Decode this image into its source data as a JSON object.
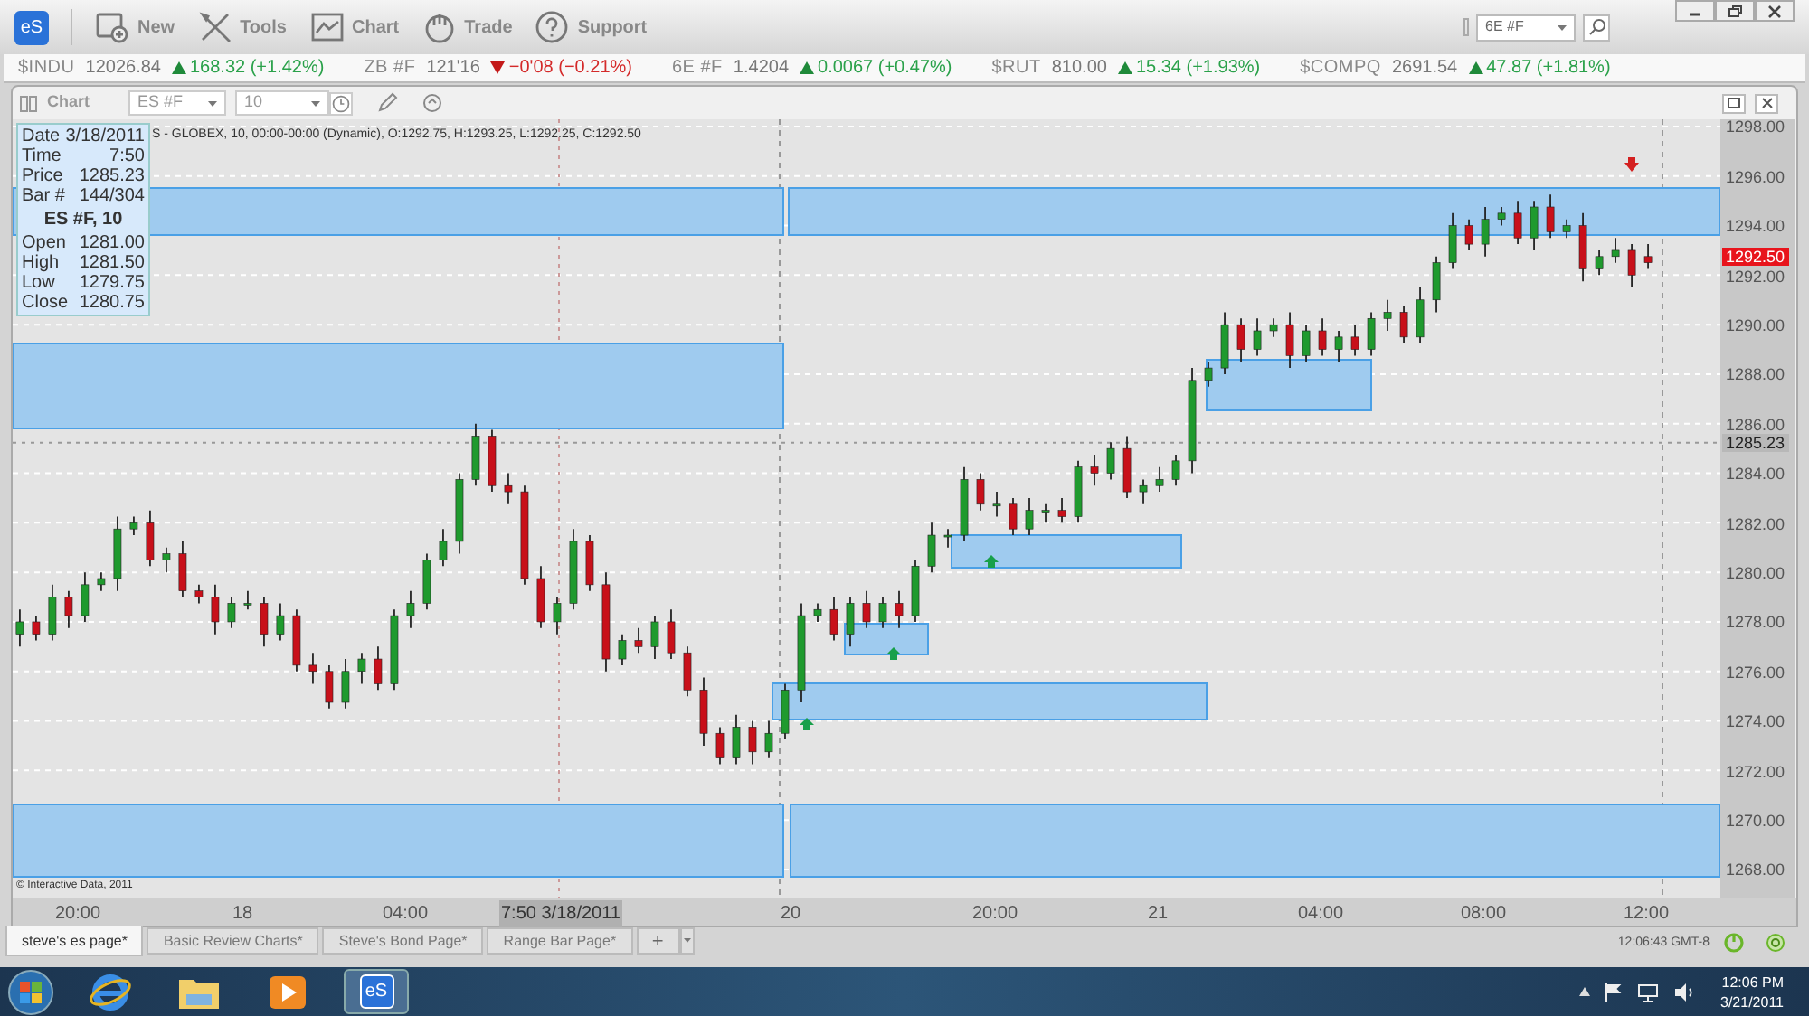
{
  "app": {
    "logo": "eS"
  },
  "toolbar": [
    {
      "kind": "new",
      "label": "New"
    },
    {
      "kind": "tools",
      "label": "Tools"
    },
    {
      "kind": "chart",
      "label": "Chart"
    },
    {
      "kind": "trade",
      "label": "Trade"
    },
    {
      "kind": "support",
      "label": "Support"
    }
  ],
  "symbol_search": {
    "value": "6E #F"
  },
  "ticker": [
    {
      "symbol": "$INDU",
      "last": "12026.84",
      "change": "168.32 (+1.42%)",
      "up": true
    },
    {
      "symbol": "ZB #F",
      "last": "121'16",
      "change": "−0'08 (−0.21%)",
      "up": false
    },
    {
      "symbol": "6E #F",
      "last": "1.4204",
      "change": "0.0067 (+0.47%)",
      "up": true
    },
    {
      "symbol": "$RUT",
      "last": "810.00",
      "change": "15.34 (+1.93%)",
      "up": true
    },
    {
      "symbol": "$COMPQ",
      "last": "2691.54",
      "change": "47.87 (+1.81%)",
      "up": true
    }
  ],
  "chart_window": {
    "title": "Chart",
    "symbol": "ES #F",
    "interval": "10",
    "info_line": "S - GLOBEX, 10, 00:00-00:00 (Dynamic), O:1292.75, H:1293.25, L:1292.25, C:1292.50",
    "data_box": {
      "rows_top": [
        {
          "label": "Date",
          "value": "3/18/2011"
        },
        {
          "label": "Time",
          "value": "7:50"
        },
        {
          "label": "Price",
          "value": "1285.23"
        },
        {
          "label": "Bar #",
          "value": "144/304"
        }
      ],
      "heading": "ES #F, 10",
      "rows_bottom": [
        {
          "label": "Open",
          "value": "1281.00"
        },
        {
          "label": "High",
          "value": "1281.50"
        },
        {
          "label": "Low",
          "value": "1279.75"
        },
        {
          "label": "Close",
          "value": "1280.75"
        }
      ]
    },
    "chart_data": {
      "type": "candlestick",
      "categories": [
        null,
        null,
        null,
        null,
        null,
        null,
        null,
        null,
        null,
        null,
        null,
        null,
        null,
        null,
        null,
        null,
        null,
        null,
        null,
        null,
        null,
        null,
        null,
        null,
        null,
        null,
        null,
        null,
        null,
        null,
        null,
        null,
        null,
        null,
        null,
        null,
        null,
        null,
        null,
        null,
        null,
        null,
        null,
        null,
        null,
        null,
        null,
        null,
        null,
        null,
        null,
        null,
        null,
        null,
        null,
        null,
        null,
        null,
        null,
        null,
        null,
        null,
        null,
        null,
        null,
        null,
        null,
        null,
        null,
        null,
        null,
        null,
        null,
        null,
        null,
        null,
        null,
        null,
        null,
        null,
        null,
        null,
        null,
        null,
        null,
        null,
        null,
        null,
        null,
        null,
        null,
        null,
        null,
        null,
        null,
        null,
        null,
        null,
        null,
        null,
        null
      ],
      "ohlc": [
        [
          1277.5,
          1278.5,
          1277,
          1278
        ],
        [
          1278,
          1278.25,
          1277.25,
          1277.5
        ],
        [
          1277.5,
          1279.5,
          1277.25,
          1279
        ],
        [
          1279,
          1279.25,
          1277.75,
          1278.25
        ],
        [
          1278.25,
          1280,
          1278,
          1279.5
        ],
        [
          1279.5,
          1280,
          1279.25,
          1279.75
        ],
        [
          1279.75,
          1282.25,
          1279.25,
          1281.75
        ],
        [
          1281.75,
          1282.25,
          1281.5,
          1282
        ],
        [
          1282,
          1282.5,
          1280.25,
          1280.5
        ],
        [
          1280.5,
          1281,
          1280,
          1280.75
        ],
        [
          1280.75,
          1281.25,
          1279,
          1279.25
        ],
        [
          1279.25,
          1279.5,
          1278.75,
          1279
        ],
        [
          1279,
          1279.5,
          1277.5,
          1278
        ],
        [
          1278,
          1279,
          1277.75,
          1278.75
        ],
        [
          1278.75,
          1279.25,
          1278.5,
          1278.75
        ],
        [
          1278.75,
          1279,
          1277,
          1277.5
        ],
        [
          1277.5,
          1278.75,
          1277.25,
          1278.25
        ],
        [
          1278.25,
          1278.5,
          1276,
          1276.25
        ],
        [
          1276.25,
          1276.75,
          1275.5,
          1276
        ],
        [
          1276,
          1276.25,
          1274.5,
          1274.75
        ],
        [
          1274.75,
          1276.5,
          1274.5,
          1276
        ],
        [
          1276,
          1276.75,
          1275.5,
          1276.5
        ],
        [
          1276.5,
          1277,
          1275.25,
          1275.5
        ],
        [
          1275.5,
          1278.5,
          1275.25,
          1278.25
        ],
        [
          1278.25,
          1279.25,
          1277.75,
          1278.75
        ],
        [
          1278.75,
          1280.75,
          1278.5,
          1280.5
        ],
        [
          1280.5,
          1281.75,
          1280.25,
          1281.25
        ],
        [
          1281.25,
          1284,
          1280.75,
          1283.75
        ],
        [
          1283.75,
          1286,
          1283.5,
          1285.5
        ],
        [
          1285.5,
          1285.75,
          1283.25,
          1283.5
        ],
        [
          1283.5,
          1284,
          1282.75,
          1283.25
        ],
        [
          1283.25,
          1283.5,
          1279.5,
          1279.75
        ],
        [
          1279.75,
          1280.25,
          1277.75,
          1278
        ],
        [
          1278,
          1279,
          1277.5,
          1278.75
        ],
        [
          1278.75,
          1281.75,
          1278.5,
          1281.25
        ],
        [
          1281.25,
          1281.5,
          1279.25,
          1279.5
        ],
        [
          1279.5,
          1280,
          1276,
          1276.5
        ],
        [
          1276.5,
          1277.5,
          1276.25,
          1277.25
        ],
        [
          1277.25,
          1277.75,
          1276.75,
          1277
        ],
        [
          1277,
          1278.25,
          1276.5,
          1278
        ],
        [
          1278,
          1278.5,
          1276.5,
          1276.75
        ],
        [
          1276.75,
          1277,
          1275,
          1275.25
        ],
        [
          1275.25,
          1275.75,
          1273,
          1273.5
        ],
        [
          1273.5,
          1273.75,
          1272.25,
          1272.5
        ],
        [
          1272.5,
          1274.25,
          1272.25,
          1273.75
        ],
        [
          1273.75,
          1274,
          1272.25,
          1272.75
        ],
        [
          1272.75,
          1274,
          1272.5,
          1273.5
        ],
        [
          1273.5,
          1275.5,
          1273.25,
          1275.25
        ],
        [
          1275.25,
          1278.75,
          1274.75,
          1278.25
        ],
        [
          1278.25,
          1278.75,
          1278,
          1278.5
        ],
        [
          1278.5,
          1279,
          1277.25,
          1277.5
        ],
        [
          1277.5,
          1279,
          1277,
          1278.75
        ],
        [
          1278.75,
          1279.25,
          1277.75,
          1278
        ],
        [
          1278,
          1279,
          1277.75,
          1278.75
        ],
        [
          1278.75,
          1279.25,
          1277.75,
          1278.25
        ],
        [
          1278.25,
          1280.5,
          1278,
          1280.25
        ],
        [
          1280.25,
          1282,
          1280,
          1281.5
        ],
        [
          1281.5,
          1281.75,
          1281,
          1281.5
        ],
        [
          1281.5,
          1284.25,
          1281.25,
          1283.75
        ],
        [
          1283.75,
          1284,
          1282.5,
          1282.75
        ],
        [
          1282.75,
          1283.25,
          1282.25,
          1282.75
        ],
        [
          1282.75,
          1283,
          1281.5,
          1281.75
        ],
        [
          1281.75,
          1283,
          1281.5,
          1282.5
        ],
        [
          1282.5,
          1282.75,
          1282,
          1282.5
        ],
        [
          1282.5,
          1283,
          1282,
          1282.25
        ],
        [
          1282.25,
          1284.5,
          1282,
          1284.25
        ],
        [
          1284.25,
          1284.75,
          1283.5,
          1284
        ],
        [
          1284,
          1285.25,
          1283.75,
          1285
        ],
        [
          1285,
          1285.5,
          1283,
          1283.25
        ],
        [
          1283.25,
          1283.75,
          1282.75,
          1283.5
        ],
        [
          1283.5,
          1284.25,
          1283.25,
          1283.75
        ],
        [
          1283.75,
          1284.75,
          1283.5,
          1284.5
        ],
        [
          1284.5,
          1288.25,
          1284,
          1287.75
        ],
        [
          1287.75,
          1288.5,
          1287.5,
          1288.25
        ],
        [
          1288.25,
          1290.5,
          1288,
          1290
        ],
        [
          1290,
          1290.25,
          1288.5,
          1289
        ],
        [
          1289,
          1290.25,
          1288.75,
          1289.75
        ],
        [
          1289.75,
          1290.25,
          1289.5,
          1290
        ],
        [
          1290,
          1290.5,
          1288.25,
          1288.75
        ],
        [
          1288.75,
          1290,
          1288.5,
          1289.75
        ],
        [
          1289.75,
          1290.25,
          1288.75,
          1289
        ],
        [
          1289,
          1289.75,
          1288.5,
          1289.5
        ],
        [
          1289.5,
          1290,
          1288.75,
          1289
        ],
        [
          1289,
          1290.5,
          1288.75,
          1290.25
        ],
        [
          1290.25,
          1291,
          1289.75,
          1290.5
        ],
        [
          1290.5,
          1290.75,
          1289.25,
          1289.5
        ],
        [
          1289.5,
          1291.5,
          1289.25,
          1291
        ],
        [
          1291,
          1292.75,
          1290.5,
          1292.5
        ],
        [
          1292.5,
          1294.5,
          1292.25,
          1294
        ],
        [
          1294,
          1294.25,
          1293,
          1293.25
        ],
        [
          1293.25,
          1294.75,
          1292.75,
          1294.25
        ],
        [
          1294.25,
          1294.75,
          1294,
          1294.5
        ],
        [
          1294.5,
          1295,
          1293.25,
          1293.5
        ],
        [
          1293.5,
          1295,
          1293,
          1294.75
        ],
        [
          1294.75,
          1295.25,
          1293.5,
          1293.75
        ],
        [
          1293.75,
          1294.25,
          1293.5,
          1294
        ],
        [
          1294,
          1294.5,
          1291.75,
          1292.25
        ],
        [
          1292.25,
          1293,
          1292,
          1292.75
        ],
        [
          1292.75,
          1293.5,
          1292.5,
          1293
        ],
        [
          1293,
          1293.25,
          1291.5,
          1292
        ],
        [
          1292.75,
          1293.25,
          1292.25,
          1292.5
        ]
      ],
      "ylim": [
        1266.83,
        1298.29
      ],
      "grid": true,
      "yticks": [
        {
          "value": 1298,
          "label": "1298.00"
        },
        {
          "value": 1296,
          "label": "1296.00"
        },
        {
          "value": 1294,
          "label": "1294.00"
        },
        {
          "value": 1292,
          "label": "1292.00"
        },
        {
          "value": 1290,
          "label": "1290.00"
        },
        {
          "value": 1288,
          "label": "1288.00"
        },
        {
          "value": 1286,
          "label": "1286.00"
        },
        {
          "value": 1284,
          "label": "1284.00"
        },
        {
          "value": 1282,
          "label": "1282.00"
        },
        {
          "value": 1280,
          "label": "1280.00"
        },
        {
          "value": 1278,
          "label": "1278.00"
        },
        {
          "value": 1276,
          "label": "1276.00"
        },
        {
          "value": 1274,
          "label": "1274.00"
        },
        {
          "value": 1272,
          "label": "1272.00"
        },
        {
          "value": 1270,
          "label": "1270.00"
        },
        {
          "value": 1268,
          "label": "1268.00"
        }
      ]
    },
    "last_price": "1292.50",
    "cursor_price": "1285.23",
    "time_axis": [
      {
        "label": "20:00",
        "highlighted": false
      },
      {
        "label": "18",
        "highlighted": false
      },
      {
        "label": "04:00",
        "highlighted": false
      },
      {
        "label": "7:50 3/18/2011",
        "highlighted": true
      },
      {
        "label": "20",
        "highlighted": false
      },
      {
        "label": "20:00",
        "highlighted": false
      },
      {
        "label": "21",
        "highlighted": false
      },
      {
        "label": "04:00",
        "highlighted": false
      },
      {
        "label": "08:00",
        "highlighted": false
      },
      {
        "label": "12:00",
        "highlighted": false
      }
    ],
    "copyright": "© Interactive Data, 2011"
  },
  "tabs": [
    {
      "label": "steve's es page*",
      "selected": true
    },
    {
      "label": "Basic Review Charts*",
      "selected": false
    },
    {
      "label": "Steve's Bond Page*",
      "selected": false
    },
    {
      "label": "Range Bar Page*",
      "selected": false
    }
  ],
  "add_tab": "+",
  "status": {
    "time": "12:06:43 GMT-8"
  },
  "taskbar": {
    "apps": [
      {
        "kind": "browser",
        "selected": false
      },
      {
        "kind": "folder",
        "selected": false
      },
      {
        "kind": "media",
        "selected": false
      },
      {
        "kind": "app",
        "label": "eS",
        "selected": true
      }
    ],
    "clock_time": "12:06 PM",
    "clock_date": "3/21/2011"
  }
}
